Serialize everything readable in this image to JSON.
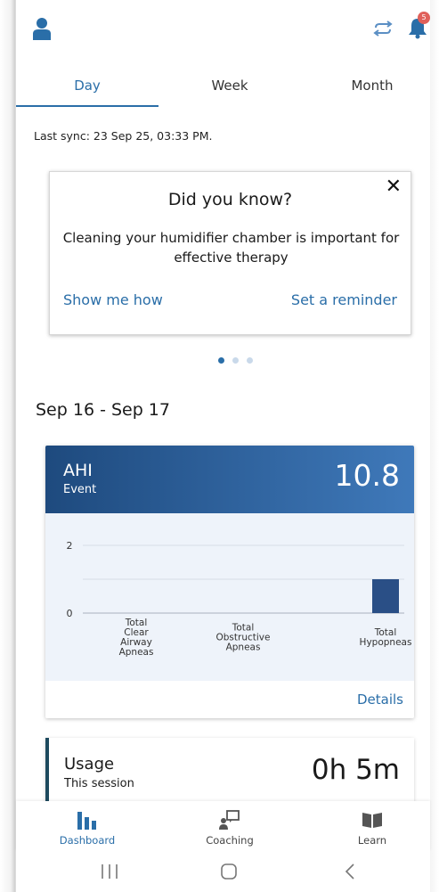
{
  "topbar": {
    "profile_icon": "person-icon",
    "sync_icon": "sync-icon",
    "bell_icon": "bell-icon",
    "notification_count": "5"
  },
  "tabs": [
    {
      "label": "Day",
      "active": true
    },
    {
      "label": "Week",
      "active": false
    },
    {
      "label": "Month",
      "active": false
    }
  ],
  "last_sync": "Last sync: 23 Sep 25, 03:33 PM.",
  "tip_card": {
    "title": "Did you know?",
    "close_label": "✕",
    "body": "Cleaning your humidifier chamber is important for effective therapy",
    "action_left": "Show me how",
    "action_right": "Set a reminder",
    "page_count": 3,
    "active_page": 0
  },
  "date_range": "Sep 16 - Sep 17",
  "ahi_card": {
    "title": "AHI",
    "subtitle": "Event",
    "value": "10.8",
    "details_label": "Details",
    "chart_data": {
      "type": "bar",
      "categories": [
        "Total Clear Airway Apneas",
        "Total Obstructive Apneas",
        "Total Hypopneas"
      ],
      "category_lines": [
        [
          "Total",
          "Clear",
          "Airway",
          "Apneas"
        ],
        [
          "Total",
          "Obstructive",
          "Apneas"
        ],
        [
          "Total",
          "Hypopneas"
        ]
      ],
      "values": [
        0,
        0,
        1
      ],
      "yticks": [
        "0",
        "2"
      ],
      "ylim": [
        0,
        2
      ],
      "bar_color": "#2a4f86",
      "grid": true
    }
  },
  "usage_card": {
    "title": "Usage",
    "subtitle": "This session",
    "value": "0h 5m"
  },
  "bottom_nav": [
    {
      "label": "Dashboard",
      "icon": "dashboard-icon",
      "active": true
    },
    {
      "label": "Coaching",
      "icon": "coaching-icon",
      "active": false
    },
    {
      "label": "Learn",
      "icon": "book-icon",
      "active": false
    }
  ],
  "colors": {
    "accent": "#2a6ea8",
    "header_dark": "#1e4a7e",
    "header_light": "#3f79ba",
    "badge": "#e0605a"
  }
}
